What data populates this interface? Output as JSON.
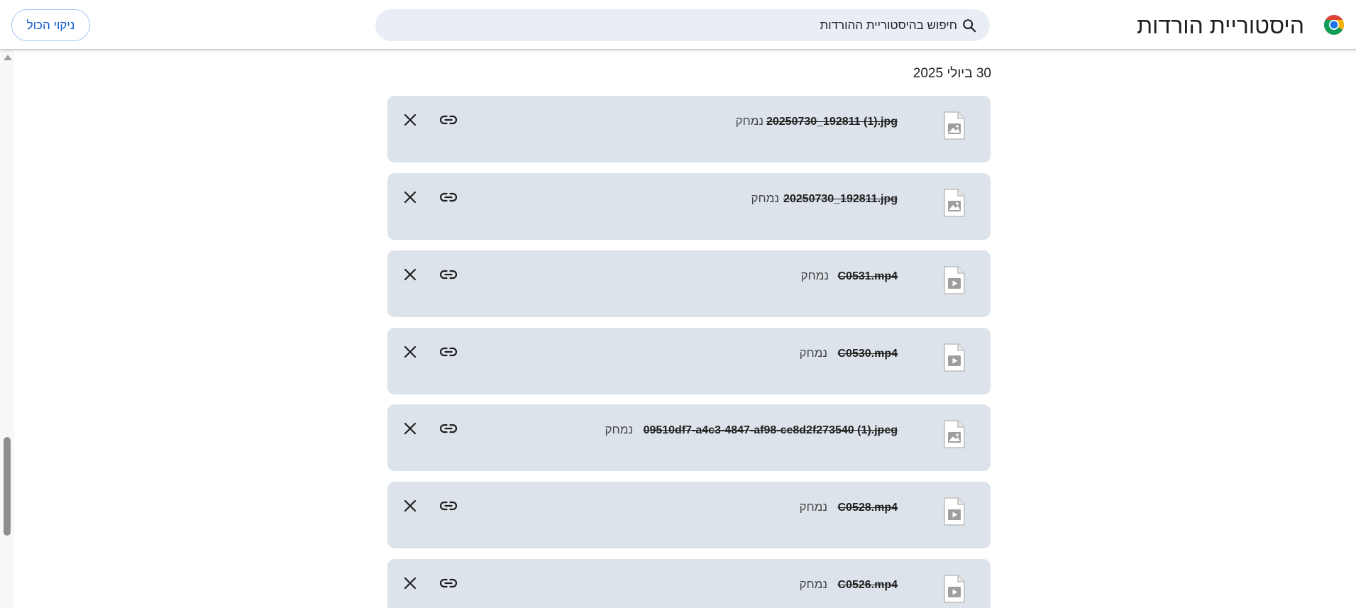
{
  "header": {
    "title": "היסטוריית הורדות",
    "search_placeholder": "חיפוש בהיסטוריית ההורדות",
    "clear_all_label": "ניקוי הכול",
    "logo_icon": "chrome-logo-icon"
  },
  "date_heading": "30 ביולי 2025",
  "downloads": [
    {
      "name": "20250730_192811 (1).jpg",
      "status": "נמחק",
      "type": "image"
    },
    {
      "name": "20250730_192811.jpg",
      "status": "נמחק",
      "type": "image"
    },
    {
      "name": "C0531.mp4",
      "status": "נמחק",
      "type": "video"
    },
    {
      "name": "C0530.mp4",
      "status": "נמחק",
      "type": "video"
    },
    {
      "name": "09510df7-a4c3-4847-af98-ce8d2f273540 (1).jpeg",
      "status": "נמחק",
      "type": "image"
    },
    {
      "name": "C0528.mp4",
      "status": "נמחק",
      "type": "video"
    },
    {
      "name": "C0526.mp4",
      "status": "נמחק",
      "type": "video"
    }
  ],
  "colors": {
    "card_bg": "#dde3ea",
    "search_bg": "#e9eef6",
    "accent": "#0b57d0"
  }
}
